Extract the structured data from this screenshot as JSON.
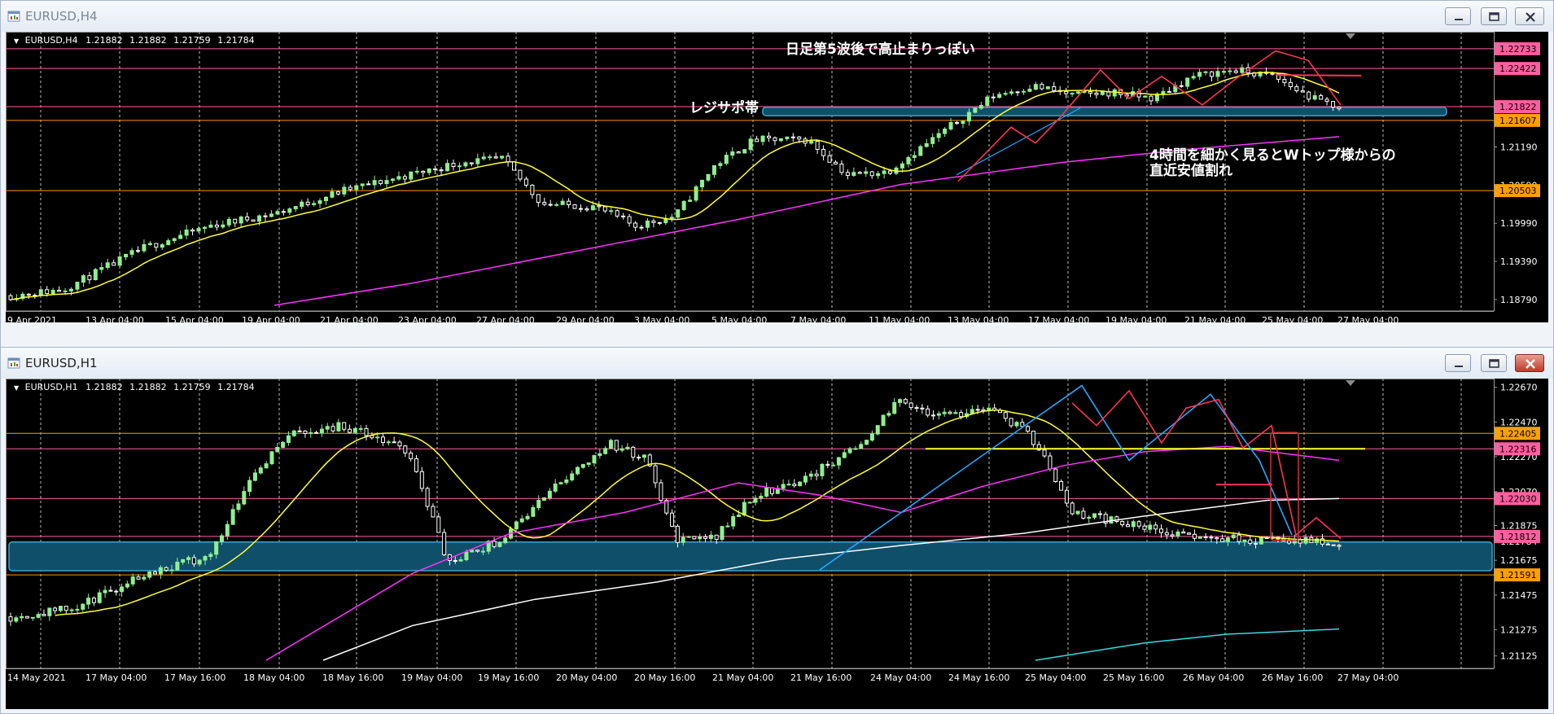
{
  "colors": {
    "background": "#000000",
    "bull_candle": "#90ee90",
    "bear_candle": "#ffffff",
    "ma_fast": "#ffff33",
    "ma_mid": "#ff33ff",
    "ma_slow": "#ffffff",
    "ma_long": "#33dddd",
    "zone": "#0f4f6a",
    "zone_border": "#3aa6c9",
    "zigzag_red": "#ff3355",
    "zigzag_blue": "#22a8ff",
    "hline_pink": "#ff5fa0",
    "hline_orange": "#ff9900",
    "label_pink": "#ff5f9e",
    "label_orange": "#ffa000"
  },
  "windows": [
    {
      "title": "EURUSD,H4",
      "active": false,
      "buttons": {
        "minimize": "minimize-icon",
        "maximize": "maximize-icon",
        "close": "close-icon"
      },
      "ohlc": {
        "symbol": "EURUSD,H4",
        "open": "1.21882",
        "high": "1.21882",
        "low": "1.21759",
        "close": "1.21784"
      },
      "price_scale": [
        "1.22733",
        "1.22422",
        "1.21822",
        "1.21607",
        "1.21190",
        "1.20590",
        "1.20503",
        "1.19990",
        "1.19390",
        "1.18790"
      ],
      "time_labels": [
        "9 Apr 2021",
        "13 Apr 04:00",
        "15 Apr 04:00",
        "19 Apr 04:00",
        "21 Apr 04:00",
        "23 Apr 04:00",
        "27 Apr 04:00",
        "29 Apr 04:00",
        "3 May 04:00",
        "5 May 04:00",
        "7 May 04:00",
        "11 May 04:00",
        "13 May 04:00",
        "17 May 04:00",
        "19 May 04:00",
        "21 May 04:00",
        "25 May 04:00",
        "27 May 04:00"
      ],
      "price_tags": [
        {
          "price": "1.22733",
          "style": "pink"
        },
        {
          "price": "1.22422",
          "style": "pink"
        },
        {
          "price": "1.21822",
          "style": "pink"
        },
        {
          "price": "1.21607",
          "style": "orange"
        },
        {
          "price": "1.20503",
          "style": "orange"
        }
      ],
      "annotations": {
        "note1": "日足第5波後で高止まりっぽい",
        "zone_label": "レジサポ帯",
        "note2_line1": "4時間を細かく見るとWトップ様からの",
        "note2_line2": "直近安値割れ"
      }
    },
    {
      "title": "EURUSD,H1",
      "active": true,
      "buttons": {
        "minimize": "minimize-icon",
        "maximize": "maximize-icon",
        "close": "close-icon"
      },
      "ohlc": {
        "symbol": "EURUSD,H1",
        "open": "1.21882",
        "high": "1.21882",
        "low": "1.21759",
        "close": "1.21784"
      },
      "price_scale": [
        "1.22670",
        "1.22470",
        "1.22405",
        "1.22316",
        "1.22270",
        "1.22070",
        "1.22030",
        "1.21875",
        "1.21812",
        "1.21784",
        "1.21675",
        "1.21591",
        "1.21475",
        "1.21275",
        "1.21125"
      ],
      "time_labels": [
        "14 May 2021",
        "17 May 04:00",
        "17 May 16:00",
        "18 May 04:00",
        "18 May 16:00",
        "19 May 04:00",
        "19 May 16:00",
        "20 May 04:00",
        "20 May 16:00",
        "21 May 04:00",
        "21 May 16:00",
        "24 May 04:00",
        "24 May 16:00",
        "25 May 04:00",
        "25 May 16:00",
        "26 May 04:00",
        "26 May 16:00",
        "27 May 04:00"
      ],
      "price_tags": [
        {
          "price": "1.22405",
          "style": "orange"
        },
        {
          "price": "1.22316",
          "style": "pink"
        },
        {
          "price": "1.22030",
          "style": "pink"
        },
        {
          "price": "1.21812",
          "style": "pink"
        },
        {
          "price": "1.21591",
          "style": "orange"
        }
      ]
    }
  ]
}
